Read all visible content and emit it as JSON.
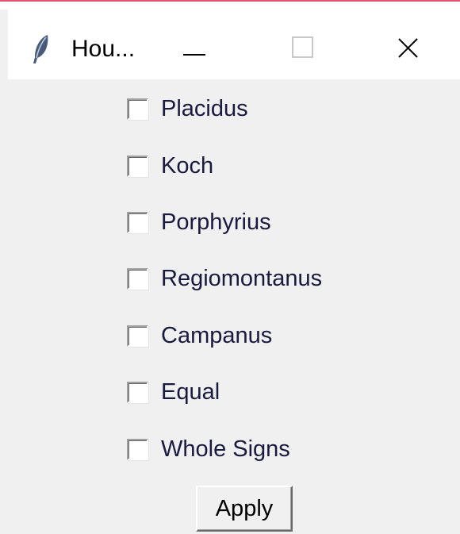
{
  "window": {
    "title": "Hou...",
    "icon": "feather-icon",
    "controls": {
      "minimize_icon": "minimize-icon",
      "maximize_icon": "maximize-icon",
      "close_icon": "close-icon"
    }
  },
  "options": [
    {
      "label": "Placidus",
      "checked": false
    },
    {
      "label": "Koch",
      "checked": false
    },
    {
      "label": "Porphyrius",
      "checked": false
    },
    {
      "label": "Regiomontanus",
      "checked": false
    },
    {
      "label": "Campanus",
      "checked": false
    },
    {
      "label": "Equal",
      "checked": false
    },
    {
      "label": "Whole Signs",
      "checked": false
    }
  ],
  "apply_label": "Apply",
  "colors": {
    "accent_border": "#e0546f",
    "background": "#f0f0f0",
    "titlebar": "#ffffff",
    "label_text": "#1a1a40"
  }
}
